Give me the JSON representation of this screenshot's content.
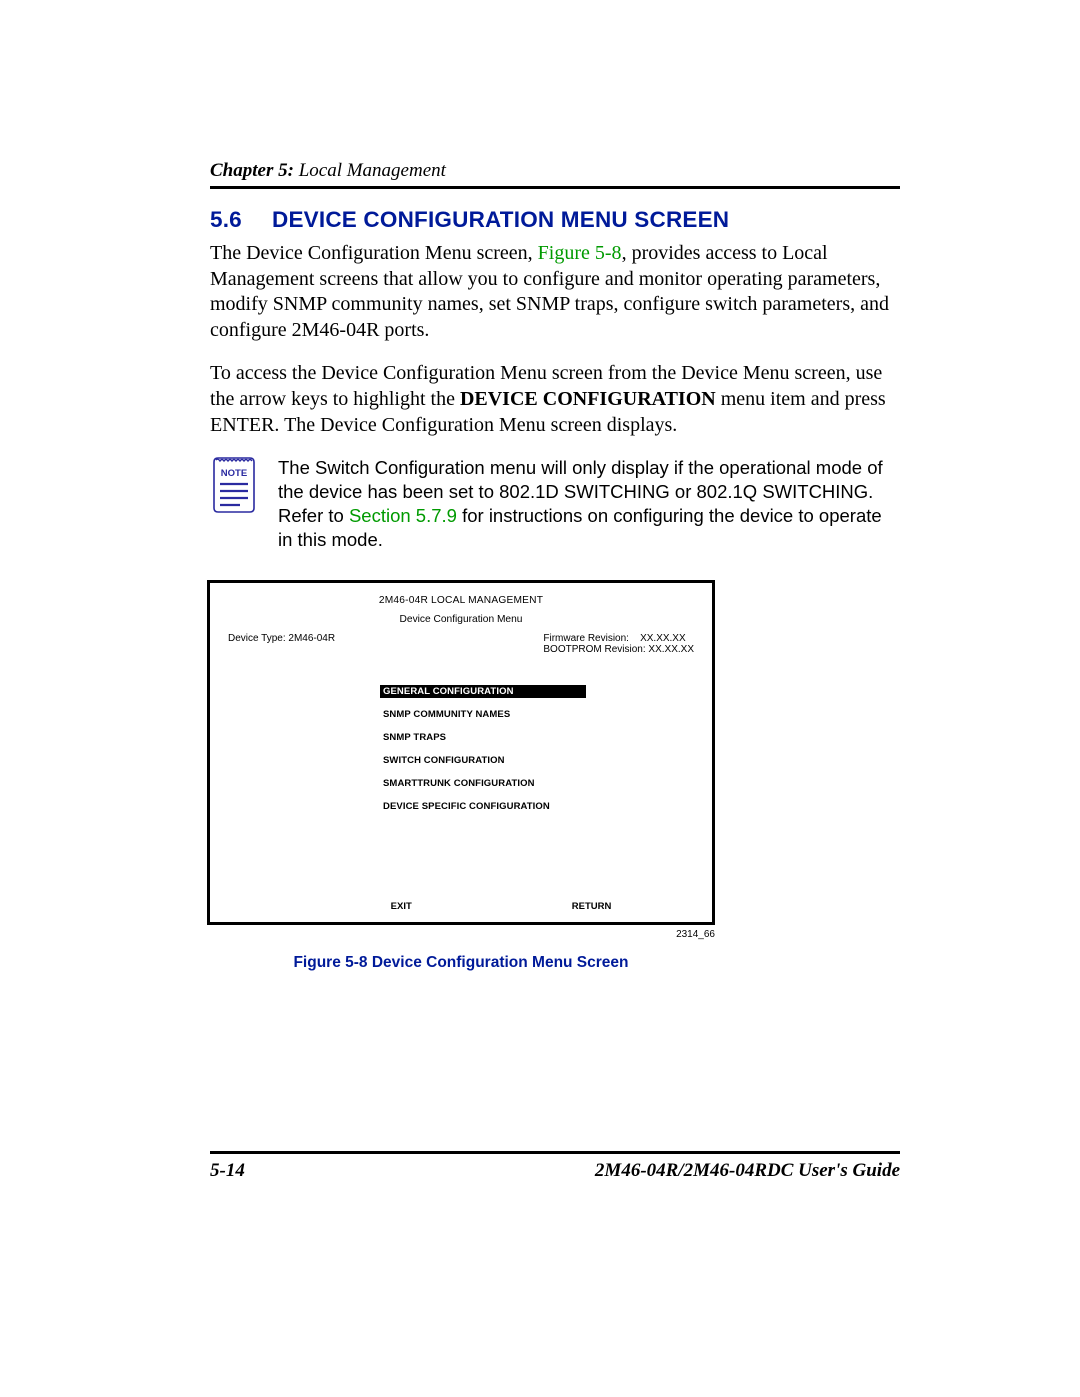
{
  "header": {
    "chapter_label": "Chapter 5:",
    "chapter_title": " Local Management"
  },
  "section": {
    "number": "5.6",
    "title": "DEVICE CONFIGURATION MENU SCREEN"
  },
  "para1": {
    "pre": "The Device Configuration Menu screen, ",
    "link": "Figure 5-8",
    "post": ", provides access to Local Management screens that allow you to configure and monitor operating parameters, modify SNMP community names, set SNMP traps, configure switch parameters, and configure 2M46-04R ports."
  },
  "para2": {
    "pre": "To access the Device Configuration Menu screen from the Device Menu screen, use the arrow keys to highlight the ",
    "bold": "DEVICE CONFIGURATION",
    "post": " menu item and press ENTER. The Device Configuration Menu screen displays."
  },
  "note": {
    "label": "NOTE",
    "text_pre": "The Switch Configuration menu will only display if the operational mode of the device has been set to 802.1D SWITCHING or 802.1Q SWITCHING. Refer to ",
    "link": "Section 5.7.9",
    "text_post": " for instructions on configuring the device to operate in this mode."
  },
  "terminal": {
    "title": "2M46-04R LOCAL MANAGEMENT",
    "subtitle": "Device Configuration  Menu",
    "device_type_label": "Device Type: 2M46-04R",
    "firmware_line": "Firmware Revision:    XX.XX.XX",
    "bootprom_line": "BOOTPROM Revision: XX.XX.XX",
    "menu": [
      "GENERAL CONFIGURATION",
      "SNMP COMMUNITY NAMES",
      "SNMP TRAPS",
      "SWITCH CONFIGURATION",
      "SMARTTRUNK CONFIGURATION",
      "DEVICE SPECIFIC CONFIGURATION"
    ],
    "exit": "EXIT",
    "return": "RETURN"
  },
  "figure": {
    "id": "2314_66",
    "caption": "Figure 5-8    Device Configuration Menu Screen"
  },
  "footer": {
    "page": "5-14",
    "guide": "2M46-04R/2M46-04RDC User's Guide"
  }
}
